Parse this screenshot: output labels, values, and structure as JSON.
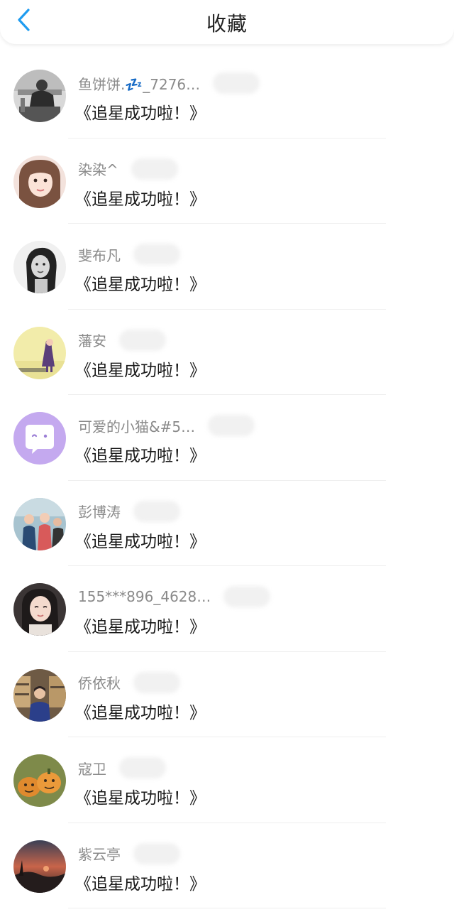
{
  "header": {
    "title": "收藏",
    "accent_color": "#1f9cf0"
  },
  "items": [
    {
      "name": "鱼饼饼.💤_7276…",
      "message": "《追星成功啦！》",
      "avatar_icon": "gym-photo-avatar"
    },
    {
      "name": "染染^",
      "message": "《追星成功啦！》",
      "avatar_icon": "girl-portrait-avatar"
    },
    {
      "name": "斐布凡",
      "message": "《追星成功啦！》",
      "avatar_icon": "bw-portrait-avatar"
    },
    {
      "name": "藩安",
      "message": "《追星成功啦！》",
      "avatar_icon": "illustration-avatar"
    },
    {
      "name": "可爱的小猫&#5…",
      "message": "《追星成功啦！》",
      "avatar_icon": "chat-bubble-avatar"
    },
    {
      "name": "彭博涛",
      "message": "《追星成功啦！》",
      "avatar_icon": "group-photo-avatar"
    },
    {
      "name": "155***896_4628…",
      "message": "《追星成功啦！》",
      "avatar_icon": "girl-selfie-avatar"
    },
    {
      "name": "侨依秋",
      "message": "《追星成功啦！》",
      "avatar_icon": "store-photo-avatar"
    },
    {
      "name": "寇卫",
      "message": "《追星成功啦！》",
      "avatar_icon": "pumpkin-avatar"
    },
    {
      "name": "紫云亭",
      "message": "《追星成功啦！》",
      "avatar_icon": "sunset-avatar"
    }
  ]
}
